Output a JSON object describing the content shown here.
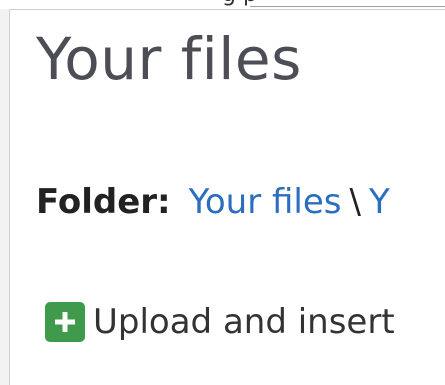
{
  "header_strip": {
    "partial_text": "g  p"
  },
  "dialog": {
    "title": "Your files",
    "breadcrumb": {
      "label": "Folder:",
      "root_link": "Your files",
      "separator": "\\",
      "next_partial": "Y"
    },
    "upload_action": {
      "label": "Upload and insert",
      "icon": "plus-icon"
    }
  },
  "colors": {
    "link": "#2a6ebf",
    "upload_icon_bg": "#3f9a4c",
    "title_text": "#4d4d55"
  }
}
